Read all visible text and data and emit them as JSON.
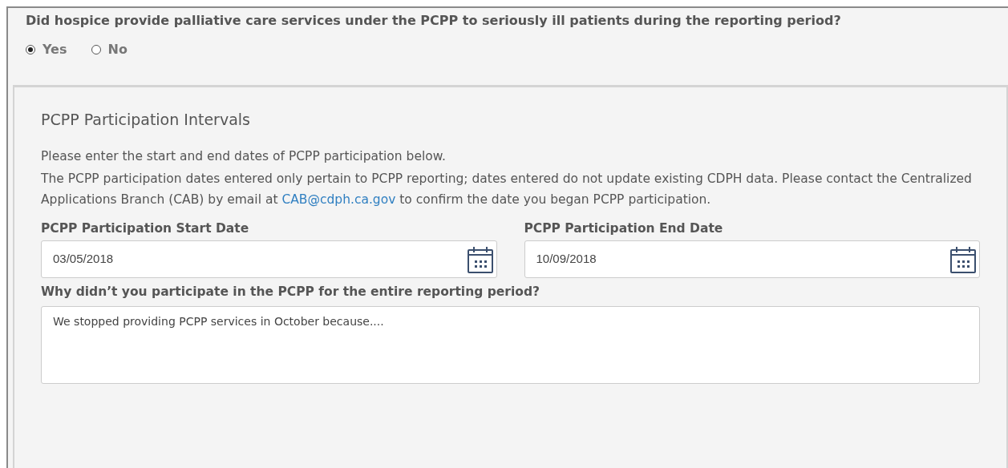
{
  "question": {
    "text": "Did hospice provide palliative care services under the PCPP to seriously ill patients during the reporting period?",
    "options": [
      {
        "label": "Yes",
        "selected": true
      },
      {
        "label": "No",
        "selected": false
      }
    ]
  },
  "panel": {
    "title": "PCPP Participation Intervals",
    "instruction": "Please enter the start and end dates of PCPP participation below.",
    "note": {
      "before": "The PCPP participation dates entered only pertain to PCPP reporting; dates entered do not update existing CDPH data. Please contact the Centralized Applications Branch (CAB) by email at",
      "link": "CAB@cdph.ca.gov",
      "after": "to confirm the date you began PCPP participation."
    },
    "dates": [
      {
        "label": "PCPP Participation Start Date",
        "value": "03/05/2018"
      },
      {
        "label": "PCPP Participation End Date",
        "value": "10/09/2018"
      }
    ],
    "reason": {
      "label": "Why didn’t you participate in the PCPP for the entire reporting period?",
      "value": "We stopped providing PCPP services in October because...."
    }
  }
}
